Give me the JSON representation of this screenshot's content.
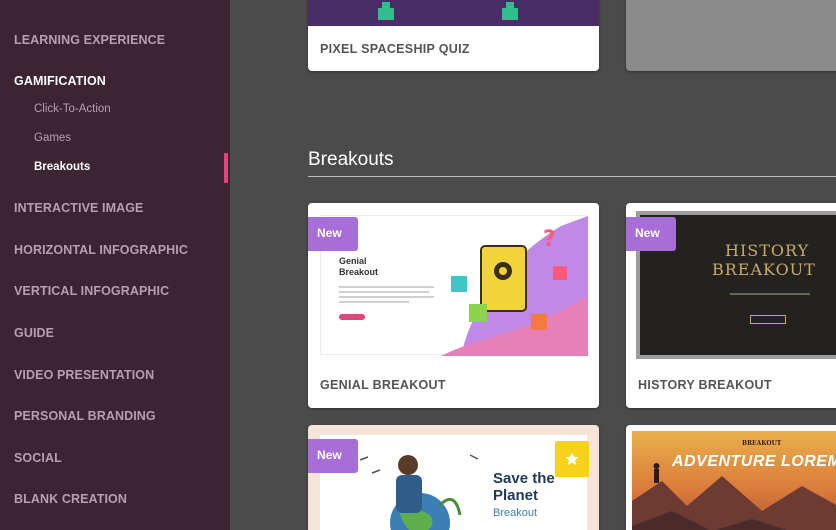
{
  "sidebar": {
    "items": [
      {
        "label": "LEARNING EXPERIENCE"
      },
      {
        "label": "GAMIFICATION"
      },
      {
        "label": "INTERACTIVE IMAGE"
      },
      {
        "label": "HORIZONTAL INFOGRAPHIC"
      },
      {
        "label": "VERTICAL INFOGRAPHIC"
      },
      {
        "label": "GUIDE"
      },
      {
        "label": "VIDEO PRESENTATION"
      },
      {
        "label": "PERSONAL BRANDING"
      },
      {
        "label": "SOCIAL"
      },
      {
        "label": "BLANK CREATION"
      }
    ],
    "sub_items": [
      {
        "label": "Click-To-Action"
      },
      {
        "label": "Games"
      },
      {
        "label": "Breakouts"
      }
    ],
    "active_sub_item": "Breakouts"
  },
  "main": {
    "top_cards": [
      {
        "label": "PIXEL SPACESHIP QUIZ"
      }
    ],
    "section_title": "Breakouts",
    "cards": [
      {
        "label": "GENIAL BREAKOUT",
        "badge": "New",
        "thumbnail": {
          "heading": "Genial Breakout"
        }
      },
      {
        "label": "HISTORY BREAKOUT",
        "badge": "New",
        "thumbnail": {
          "heading_line1": "HISTORY",
          "heading_line2": "BREAKOUT"
        }
      },
      {
        "badge": "New",
        "featured": true,
        "thumbnail": {
          "heading_line1": "Save the",
          "heading_line2": "Planet",
          "subheading": "Breakout"
        }
      },
      {
        "thumbnail": {
          "small_label": "BREAKOUT",
          "heading": "ADVENTURE LOREM IP"
        }
      }
    ]
  },
  "colors": {
    "sidebar_bg": "#3d2433",
    "sidebar_text": "#b99fae",
    "active_marker": "#e0457b",
    "badge_new": "#a66ed6",
    "featured_badge": "#f6d21a",
    "main_bg": "#4b4b4b"
  }
}
